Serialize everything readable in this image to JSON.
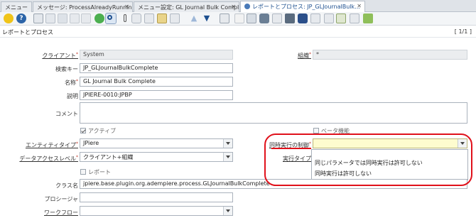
{
  "tabs": [
    {
      "label": "メニュー",
      "active": false
    },
    {
      "label": "メッセージ: ProcessAlreadyRunning",
      "active": false
    },
    {
      "label": "メニュー設定: GL Journal Bulk Comple",
      "active": false
    },
    {
      "label": "レポートとプロセス: JP_GLJournalBulk...",
      "active": true
    }
  ],
  "toolbar": {
    "icons": [
      "undo-icon",
      "help-icon",
      "new-record-icon",
      "copy-icon",
      "save-icon",
      "delete-icon",
      "refresh-icon",
      "find-icon",
      "attachment-icon",
      "chat-icon",
      "history-icon",
      "home-icon",
      "grid-toggle-icon",
      "up-icon",
      "down-icon",
      "report-icon",
      "archive-icon",
      "print-preview-icon",
      "print-icon",
      "zoom-across-icon",
      "active-workflows-icon",
      "request-icon",
      "product-info-icon",
      "process-icon",
      "end-icon"
    ]
  },
  "header": {
    "title": "レポートとプロセス",
    "record_count": "[ 1/1 ]"
  },
  "form": {
    "client_label": "クライアント",
    "client_value": "System",
    "org_label": "組織",
    "org_value": "*",
    "search_key_label": "検索キー",
    "search_key_value": "JP_GLJournalBulkComplete",
    "name_label": "名称",
    "name_value": "GL Journal Bulk Complete",
    "description_label": "説明",
    "description_value": "JPIERE-0010:JPBP",
    "comment_label": "コメント",
    "comment_value": "",
    "active_label": "アクティブ",
    "beta_label": "ベータ機能",
    "entity_type_label": "エンティティタイプ",
    "entity_type_value": "JPiere",
    "concurrent_label": "同時実行の制御",
    "concurrent_value": "",
    "data_access_label": "データアクセスレベル",
    "data_access_value": "クライアント+組織",
    "exec_type_label": "実行タイプ",
    "report_label": "レポート",
    "classname_label": "クラス名",
    "classname_value": "jpiere.base.plugin.org.adempiere.process.GLJournalBulkComplete",
    "procedure_label": "プロシージャ",
    "procedure_value": "",
    "workflow_label": "ワークフロー",
    "workflow_value": ""
  },
  "concurrent_options": [
    "同じパラメータでは同時実行は許可しない",
    "同時実行は許可しない"
  ],
  "colors": {
    "highlight": "#e0111b",
    "mandatory_field": "#fefccf"
  }
}
